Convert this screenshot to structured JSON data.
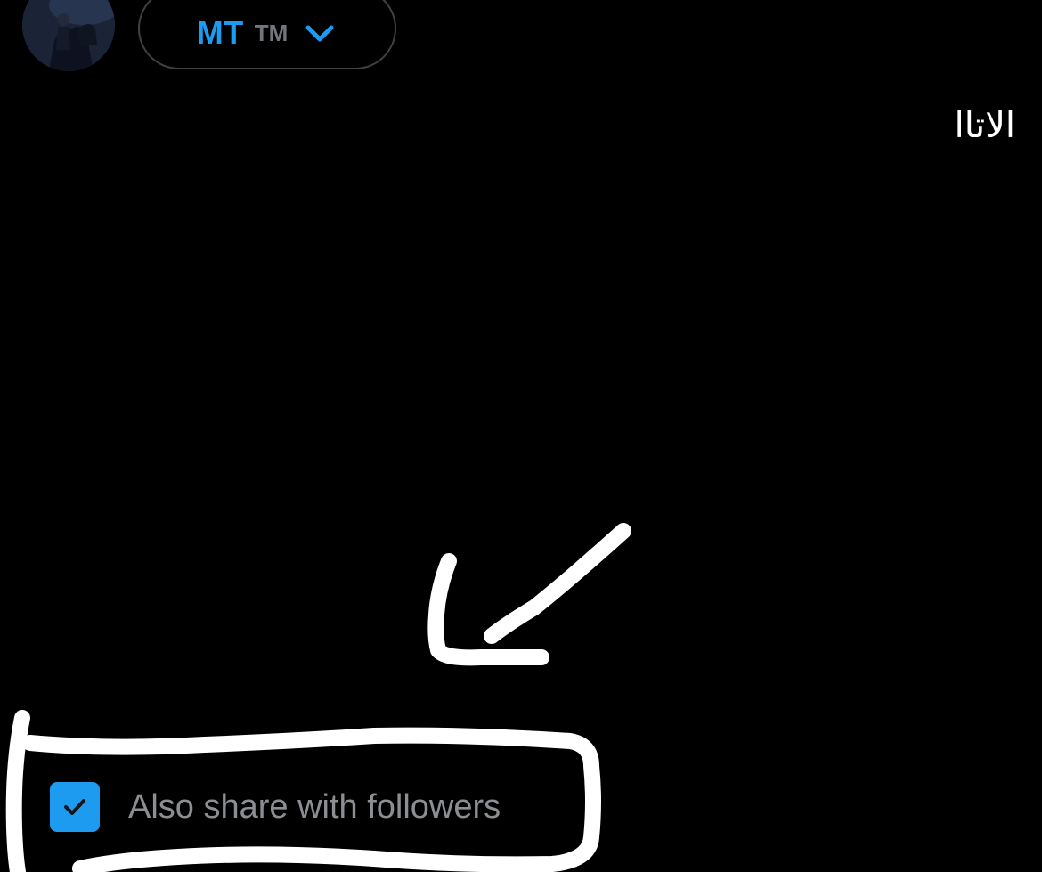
{
  "composer": {
    "avatar": {
      "icon": "user-avatar"
    },
    "audience": {
      "name": "MT",
      "suffix": "TM",
      "icon": "chevron-down-icon",
      "color": "#1d9bf0"
    },
    "post_text": "الاتاا"
  },
  "share_option": {
    "checked": true,
    "label": "Also share with followers",
    "checkbox_color": "#1d9bf0"
  },
  "annotations": {
    "arrow_icon": "hand-drawn-arrow-icon",
    "outline_icon": "hand-drawn-highlight-box",
    "color": "#ffffff"
  }
}
